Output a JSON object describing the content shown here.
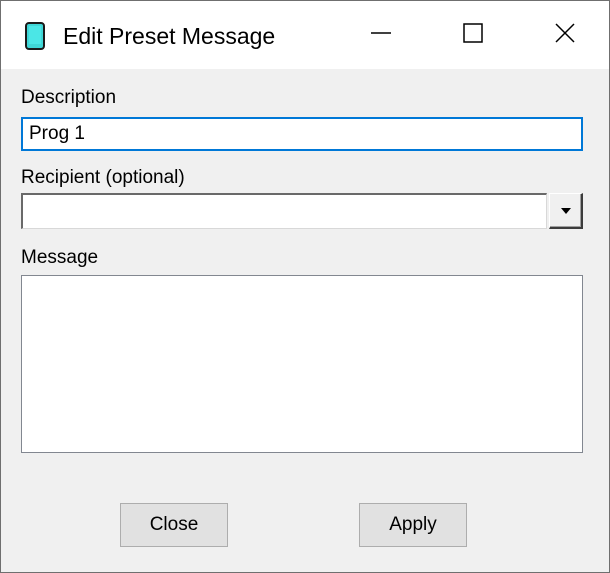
{
  "window": {
    "title": "Edit Preset Message",
    "icon": "tablet-icon",
    "accent_color": "#0078d7",
    "icon_color": "#3fd6d6"
  },
  "titlebar_buttons": {
    "minimize": "minimize-icon",
    "maximize": "maximize-icon",
    "close": "close-icon"
  },
  "form": {
    "description_label": "Description",
    "description_value": "Prog 1",
    "recipient_label": "Recipient (optional)",
    "recipient_value": "",
    "message_label": "Message",
    "message_value": ""
  },
  "buttons": {
    "close_label": "Close",
    "apply_label": "Apply"
  }
}
